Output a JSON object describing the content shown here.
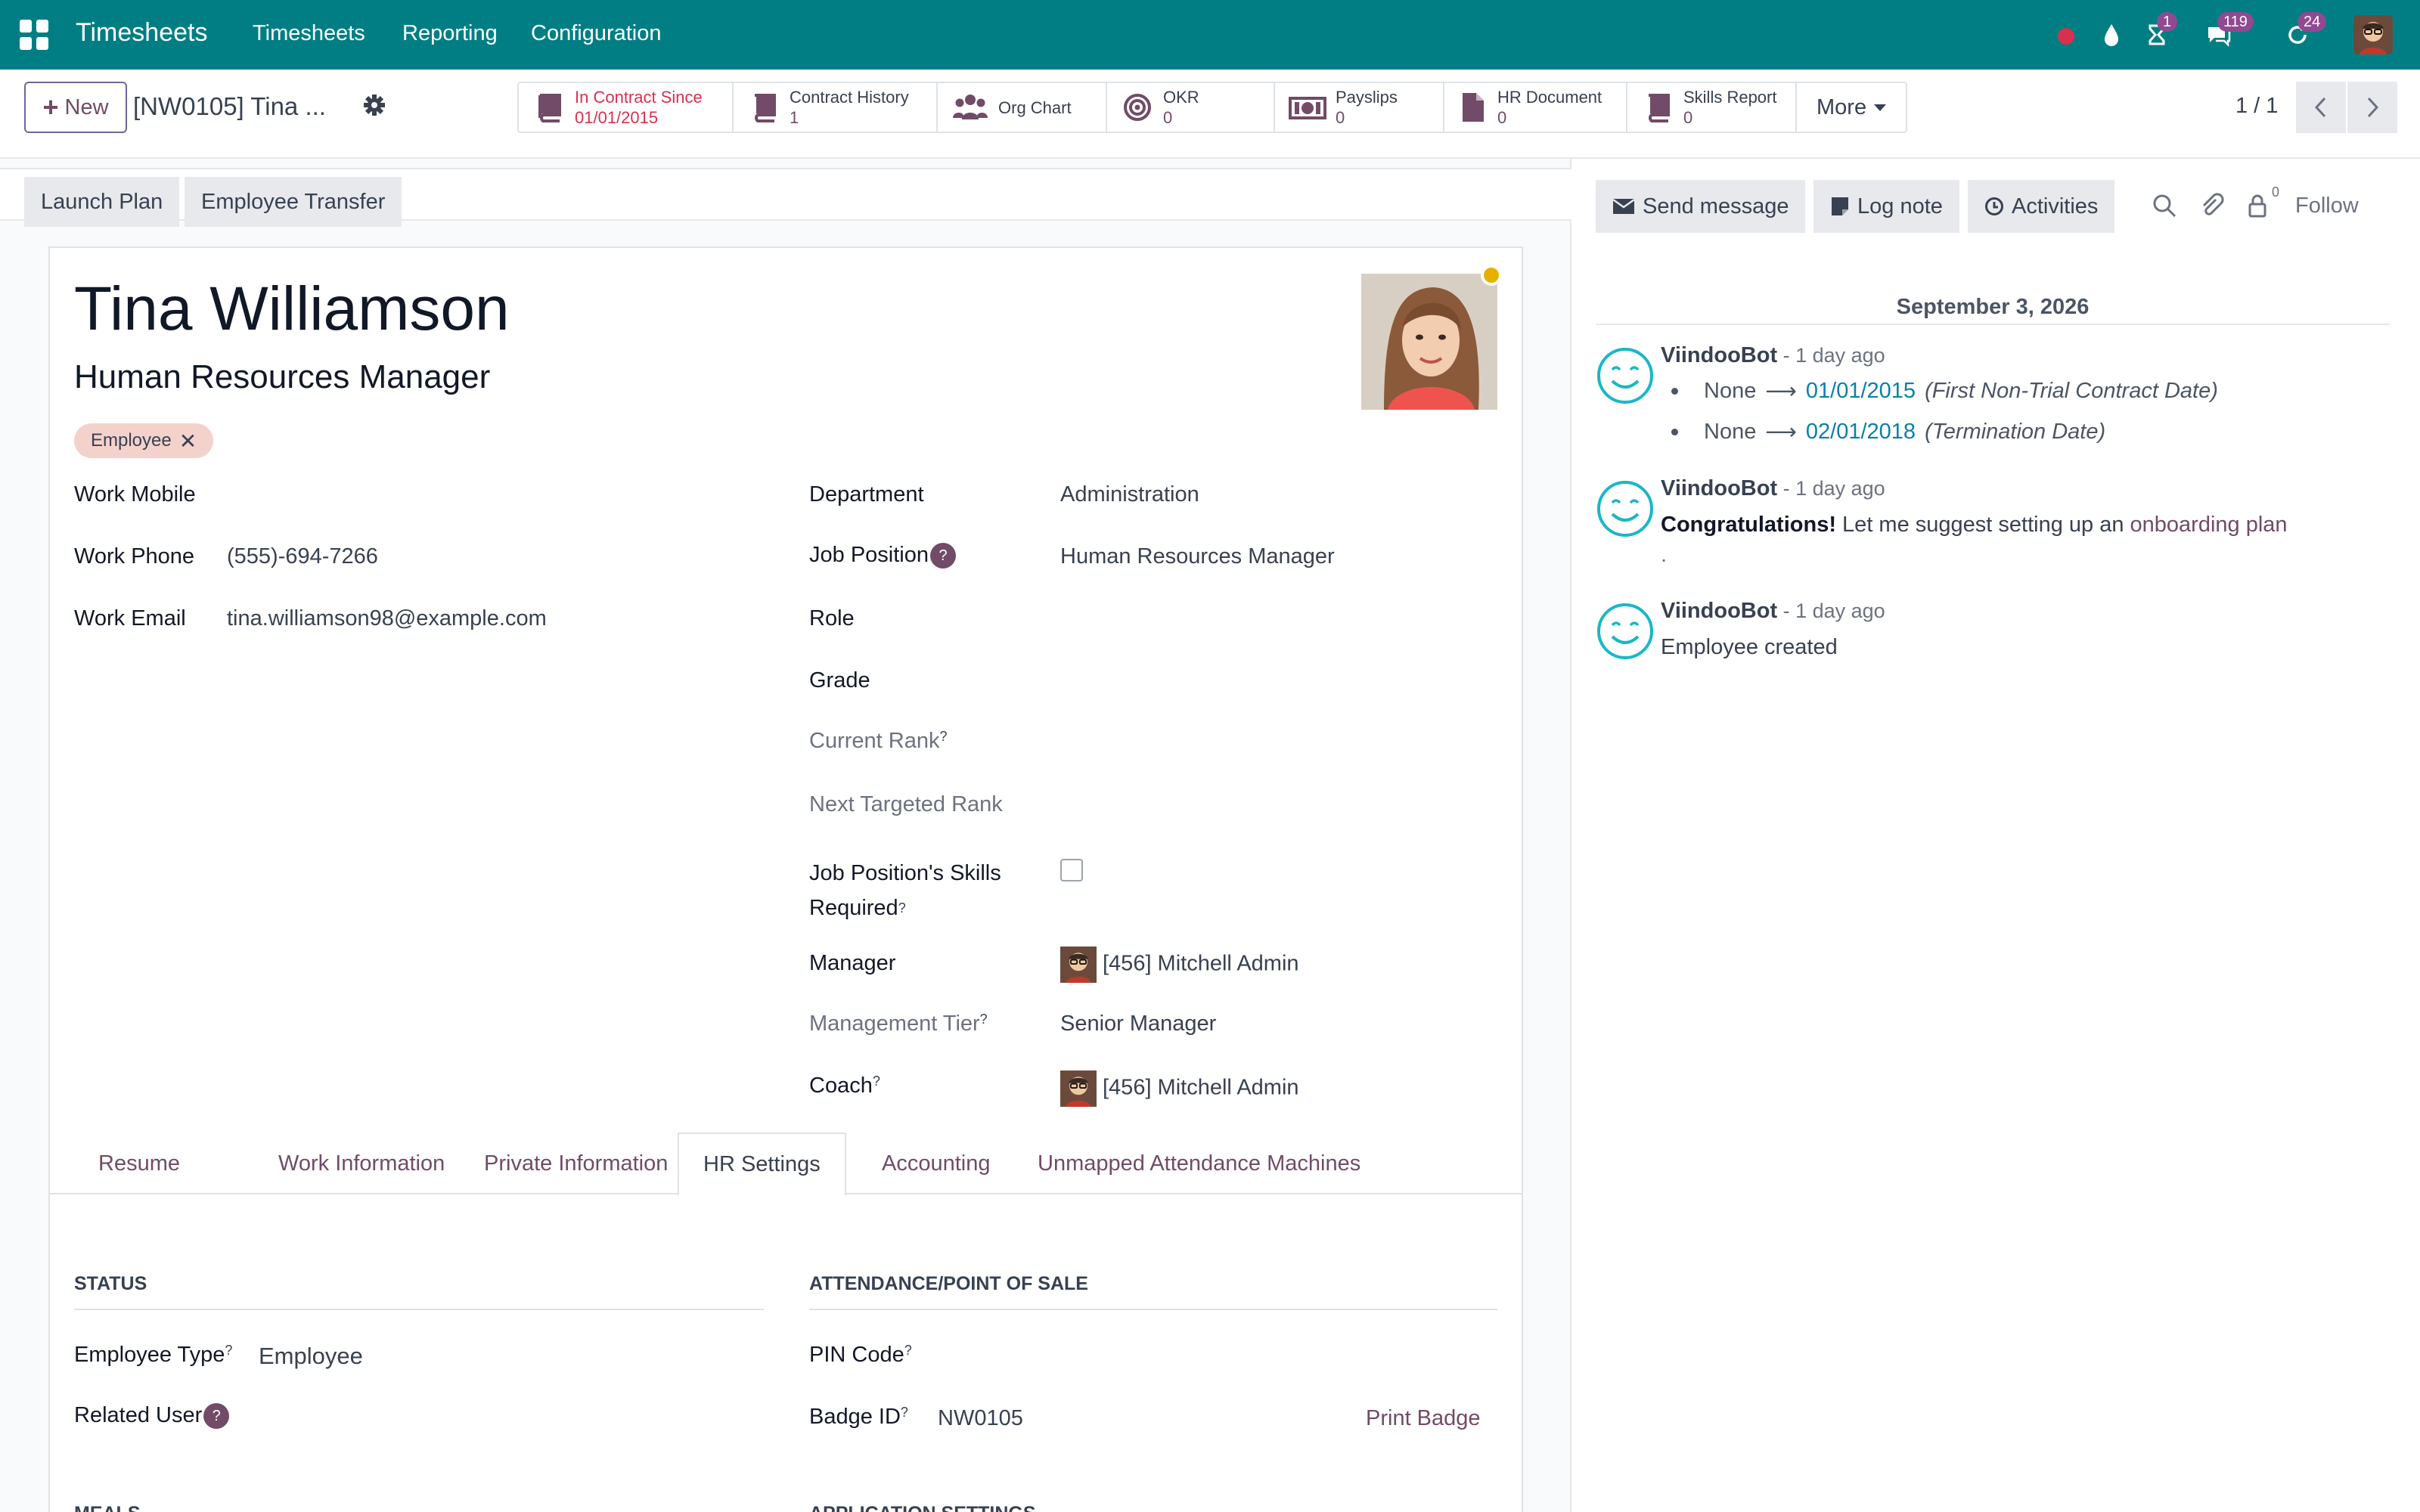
{
  "navbar": {
    "app_name": "Timesheets",
    "menu": [
      "Timesheets",
      "Reporting",
      "Configuration"
    ],
    "badges": {
      "activities": "1",
      "messages": "119",
      "updates": "24"
    },
    "icons": [
      "apps-grid-icon",
      "record-dot-icon",
      "droplet-icon",
      "hourglass-icon",
      "chat-icon",
      "refresh-icon",
      "user-avatar"
    ],
    "accent_color": "#017e84"
  },
  "control": {
    "new_label": "New",
    "record_title": "[NW0105] Tina ...",
    "smart_buttons": [
      {
        "label": "In Contract Since",
        "value": "01/01/2015",
        "icon": "book-icon"
      },
      {
        "label": "Contract History",
        "value": "1",
        "icon": "book-icon"
      },
      {
        "label": "Org Chart",
        "value": "",
        "icon": "users-icon"
      },
      {
        "label": "OKR",
        "value": "0",
        "icon": "target-icon"
      },
      {
        "label": "Payslips",
        "value": "0",
        "icon": "money-icon"
      },
      {
        "label": "HR Document",
        "value": "0",
        "icon": "document-icon"
      },
      {
        "label": "Skills Report",
        "value": "0",
        "icon": "book-icon"
      }
    ],
    "more_label": "More",
    "pager": "1 / 1"
  },
  "actions": {
    "launch_plan": "Launch Plan",
    "employee_transfer": "Employee Transfer"
  },
  "employee": {
    "name": "Tina Williamson",
    "job_title": "Human Resources Manager",
    "tag": "Employee",
    "left_fields": [
      {
        "label": "Work Mobile",
        "value": ""
      },
      {
        "label": "Work Phone",
        "value": "(555)-694-7266"
      },
      {
        "label": "Work Email",
        "value": "tina.williamson98@example.com"
      }
    ],
    "department_label": "Department",
    "department": "Administration",
    "job_position_label": "Job Position",
    "job_position": "Human Resources Manager",
    "role_label": "Role",
    "grade_label": "Grade",
    "current_rank_label": "Current Rank",
    "next_rank_label": "Next Targeted Rank",
    "skills_required_label": "Job Position's Skills Required",
    "manager_label": "Manager",
    "manager": "[456] Mitchell Admin",
    "management_tier_label": "Management Tier",
    "management_tier": "Senior Manager",
    "coach_label": "Coach",
    "coach": "[456] Mitchell Admin",
    "help_mark": "?"
  },
  "tabs": [
    "Resume",
    "Work Information",
    "Private Information",
    "HR Settings",
    "Accounting",
    "Unmapped Attendance Machines"
  ],
  "active_tab": "HR Settings",
  "hr_settings": {
    "status_heading": "STATUS",
    "attendance_heading": "ATTENDANCE/POINT OF SALE",
    "employee_type_label": "Employee Type",
    "employee_type": "Employee",
    "related_user_label": "Related User",
    "pin_code_label": "PIN Code",
    "badge_id_label": "Badge ID",
    "badge_id": "NW0105",
    "print_badge": "Print Badge",
    "meals_heading": "MEALS",
    "application_heading": "APPLICATION SETTINGS"
  },
  "chatter": {
    "send_message": "Send message",
    "log_note": "Log note",
    "activities": "Activities",
    "follower_count": "0",
    "follow": "Follow",
    "date": "September 3, 2026",
    "messages": [
      {
        "author": "ViindooBot",
        "time": " - 1 day ago",
        "tracking": [
          {
            "old": "None",
            "new": "01/01/2015",
            "field": "(First Non-Trial Contract Date)"
          },
          {
            "old": "None",
            "new": "02/01/2018",
            "field": "(Termination Date)"
          }
        ]
      },
      {
        "author": "ViindooBot",
        "time": " - 1 day ago",
        "bold": "Congratulations!",
        "text": " Let me suggest setting up an ",
        "link": "onboarding plan",
        "trail": "."
      },
      {
        "author": "ViindooBot",
        "time": " - 1 day ago",
        "text": "Employee created"
      }
    ]
  }
}
